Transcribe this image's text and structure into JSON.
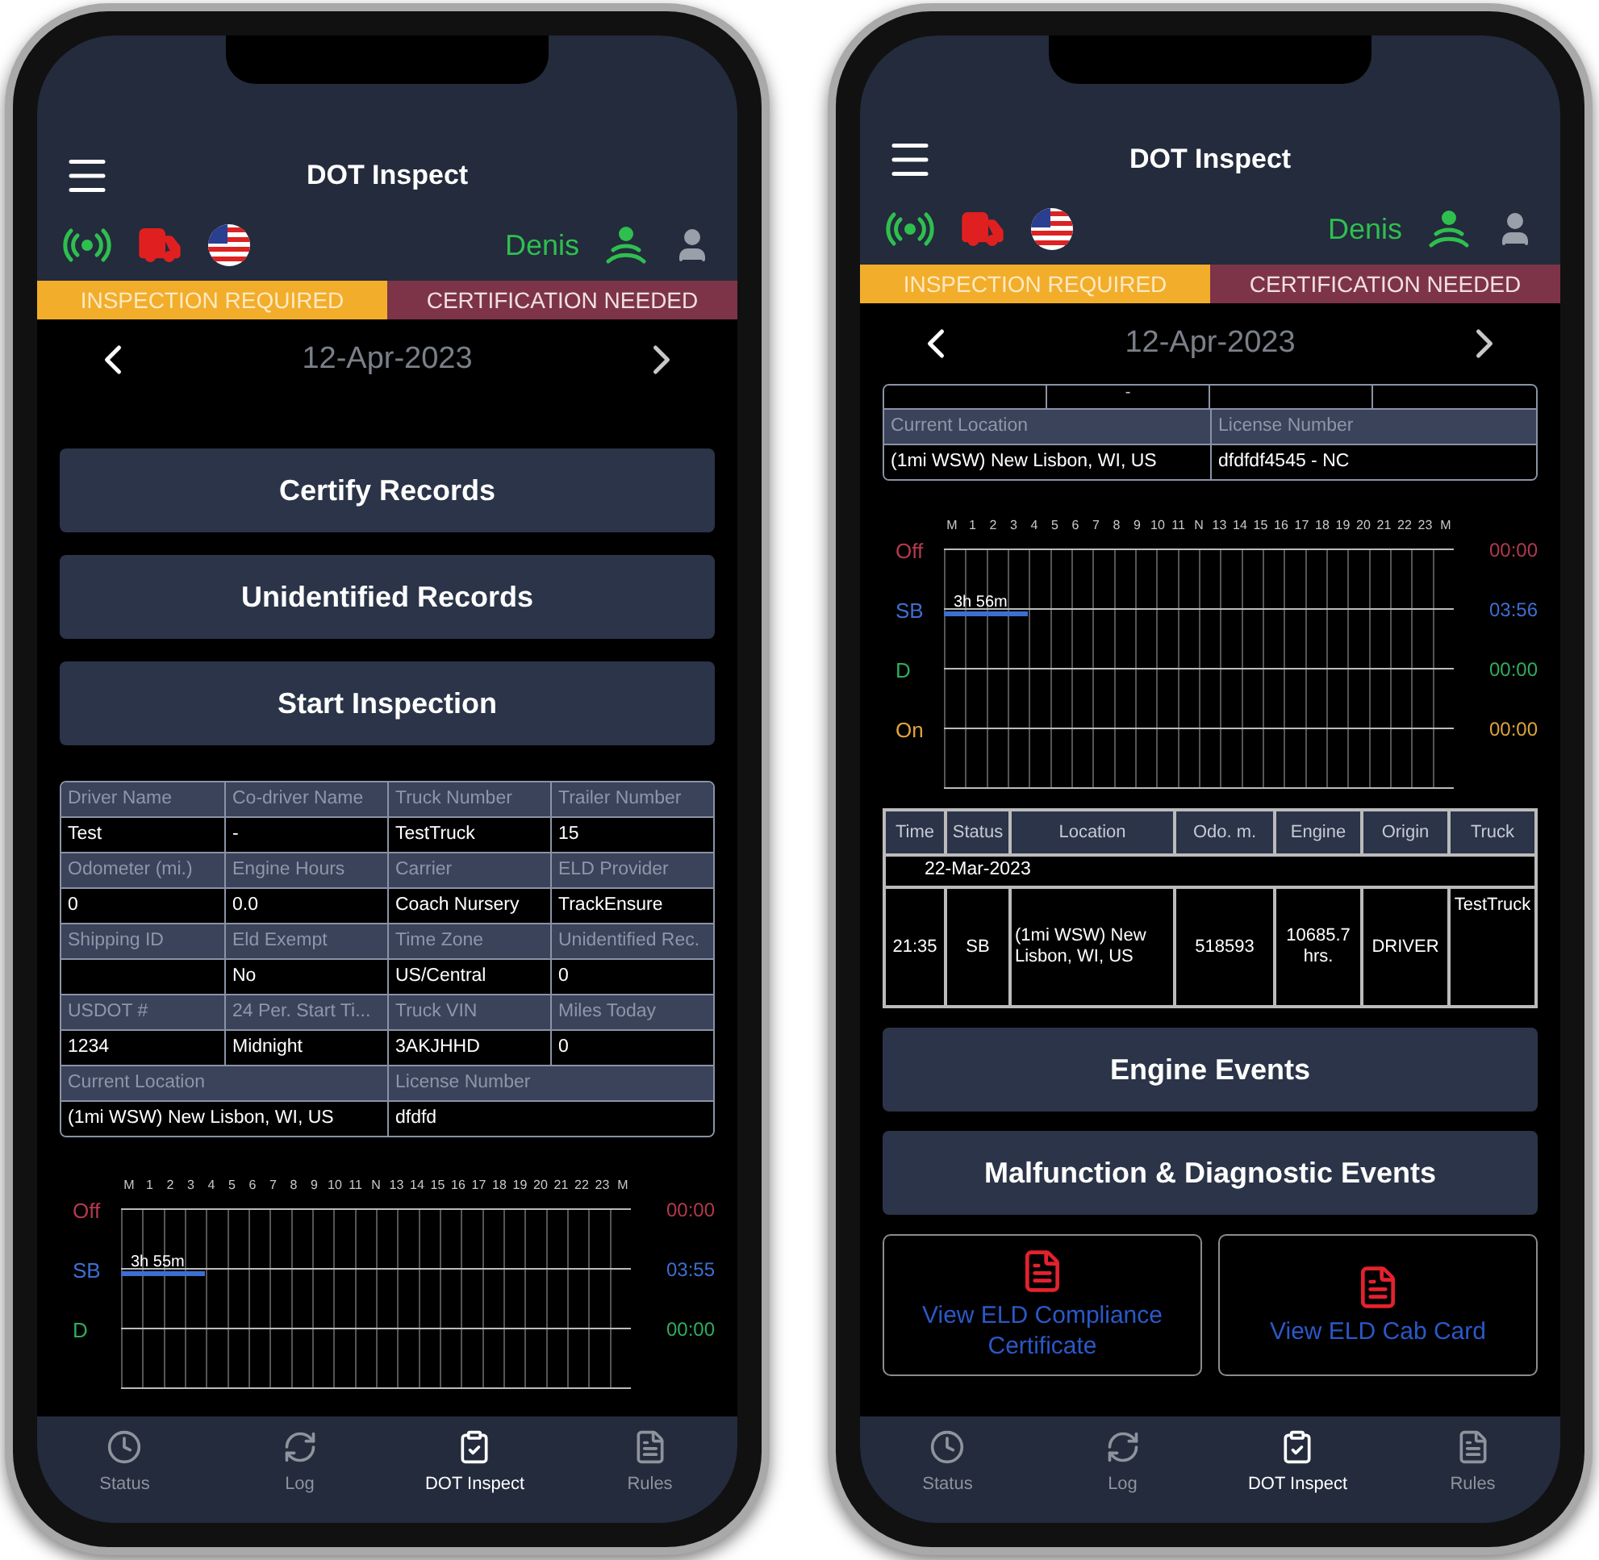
{
  "phones": [
    {
      "header": {
        "title": "DOT Inspect"
      },
      "driver_name": "Denis",
      "banners": [
        {
          "text": "INSPECTION REQUIRED",
          "kind": "warning"
        },
        {
          "text": "CERTIFICATION NEEDED",
          "kind": "alert"
        }
      ],
      "date": "12-Apr-2023",
      "sections": [
        {
          "kind": "button",
          "label": "Certify Records"
        },
        {
          "kind": "button",
          "label": "Unidentified Records"
        },
        {
          "kind": "button",
          "label": "Start Inspection"
        },
        {
          "kind": "info_table",
          "rows": [
            {
              "kind": "label",
              "cells": [
                "Driver Name",
                "Co-driver Name",
                "Truck Number",
                "Trailer Number"
              ]
            },
            {
              "kind": "value",
              "cells": [
                "Test",
                "-",
                "TestTruck",
                "15"
              ]
            },
            {
              "kind": "label",
              "cells": [
                "Odometer (mi.)",
                "Engine Hours",
                "Carrier",
                "ELD Provider"
              ]
            },
            {
              "kind": "value",
              "cells": [
                "0",
                "0.0",
                "Coach Nursery",
                "TrackEnsure"
              ]
            },
            {
              "kind": "label",
              "cells": [
                "Shipping ID",
                "Eld Exempt",
                "Time Zone",
                "Unidentified Rec."
              ]
            },
            {
              "kind": "value",
              "cells": [
                null,
                "No",
                "US/Central",
                "0"
              ]
            },
            {
              "kind": "label",
              "cells": [
                "USDOT #",
                "24 Per. Start Ti...",
                "Truck VIN",
                "Miles Today"
              ]
            },
            {
              "kind": "value",
              "cells": [
                "1234",
                "Midnight",
                "3AKJHHD",
                "0"
              ]
            },
            {
              "kind": "label",
              "cells": [
                "Current Location",
                "License Number"
              ]
            },
            {
              "kind": "value",
              "cells": [
                "(1mi WSW) New Lisbon, WI, US",
                "dfdfd"
              ]
            }
          ]
        },
        {
          "kind": "log_chart",
          "hours": [
            "M",
            "1",
            "2",
            "3",
            "4",
            "5",
            "6",
            "7",
            "8",
            "9",
            "10",
            "11",
            "N",
            "13",
            "14",
            "15",
            "16",
            "17",
            "18",
            "19",
            "20",
            "21",
            "22",
            "23",
            "M"
          ],
          "rows": [
            {
              "label": "Off",
              "total": "00:00",
              "color": "#b23a4c"
            },
            {
              "label": "SB",
              "total": "03:55",
              "color": "#3d6fd1",
              "segment": {
                "label": "3h 55m",
                "level": 0.163
              }
            },
            {
              "label": "D",
              "total": "00:00",
              "color": "#2fae5c"
            }
          ]
        }
      ],
      "tabs": [
        {
          "label": "Status",
          "selected": false
        },
        {
          "label": "Log",
          "selected": false
        },
        {
          "label": "DOT Inspect",
          "selected": true
        },
        {
          "label": "Rules",
          "selected": false
        }
      ]
    },
    {
      "header": {
        "title": "DOT Inspect"
      },
      "driver_name": "Denis",
      "banners": [
        {
          "text": "INSPECTION REQUIRED",
          "kind": "warning"
        },
        {
          "text": "CERTIFICATION NEEDED",
          "kind": "alert"
        }
      ],
      "date": "12-Apr-2023",
      "sections": [
        {
          "kind": "info_table",
          "partial_top": "-",
          "rows": [
            {
              "kind": "label",
              "cells": [
                "Current Location",
                "License Number"
              ]
            },
            {
              "kind": "value",
              "cells": [
                "(1mi WSW) New Lisbon, WI, US",
                "dfdfdf4545  -  NC"
              ]
            }
          ]
        },
        {
          "kind": "log_chart",
          "hours": [
            "M",
            "1",
            "2",
            "3",
            "4",
            "5",
            "6",
            "7",
            "8",
            "9",
            "10",
            "11",
            "N",
            "13",
            "14",
            "15",
            "16",
            "17",
            "18",
            "19",
            "20",
            "21",
            "22",
            "23",
            "M"
          ],
          "rows": [
            {
              "label": "Off",
              "total": "00:00",
              "color": "#b23a4c"
            },
            {
              "label": "SB",
              "total": "03:56",
              "color": "#3d6fd1",
              "segment": {
                "label": "3h 56m",
                "level": 0.164
              }
            },
            {
              "label": "D",
              "total": "00:00",
              "color": "#2fae5c"
            },
            {
              "label": "On",
              "total": "00:00",
              "color": "#e0a43a"
            }
          ]
        },
        {
          "kind": "events_table",
          "columns": [
            "Time",
            "Status",
            "Location",
            "Odo. m.",
            "Engine",
            "Origin",
            "Truck"
          ],
          "date": "22-Mar-2023",
          "rows": [
            [
              "21:35",
              "SB",
              "(1mi WSW) New Lisbon, WI, US",
              "518593",
              "10685.7 hrs.",
              "DRIVER",
              "TestTruck"
            ]
          ]
        },
        {
          "kind": "button",
          "label": "Engine Events"
        },
        {
          "kind": "button",
          "label": "Malfunction & Diagnostic Events"
        },
        {
          "kind": "doc_links",
          "items": [
            "View ELD Compliance Certificate",
            "View ELD Cab Card"
          ]
        }
      ],
      "tabs": [
        {
          "label": "Status",
          "selected": false
        },
        {
          "label": "Log",
          "selected": false
        },
        {
          "label": "DOT Inspect",
          "selected": true
        },
        {
          "label": "Rules",
          "selected": false
        }
      ]
    }
  ]
}
